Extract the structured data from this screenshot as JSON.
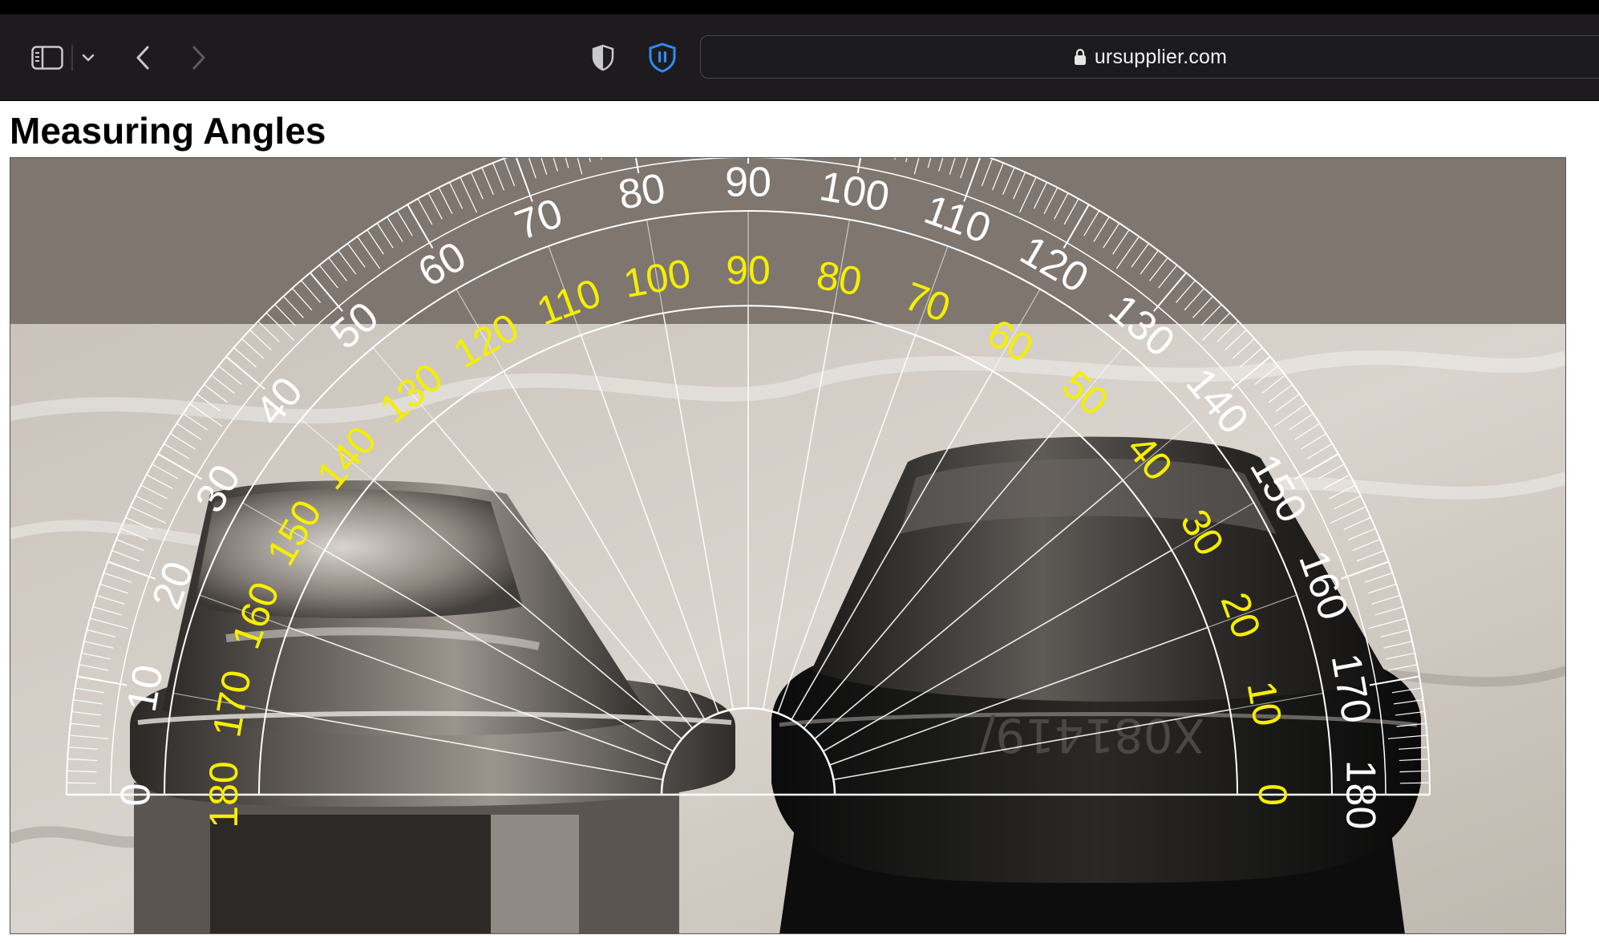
{
  "browser": {
    "url": "ursupplier.com",
    "icons": {
      "sidebar_toggle": "sidebar-icon",
      "sidebar_menu": "chevron-down-icon",
      "back": "chevron-left-icon",
      "forward": "chevron-right-icon",
      "privacy": "shield-icon",
      "extension": "password-manager-shield-icon",
      "secure": "lock-icon"
    },
    "colors": {
      "toolbar": "#1d1b1e",
      "extension_accent": "#2f8cf2"
    }
  },
  "page": {
    "title": "Measuring Angles"
  },
  "protractor": {
    "outer_labels": [
      "0",
      "10",
      "20",
      "30",
      "40",
      "50",
      "60",
      "70",
      "80",
      "90",
      "100",
      "110",
      "120",
      "130",
      "140",
      "150",
      "160",
      "170",
      "180"
    ],
    "inner_labels": [
      "180",
      "170",
      "160",
      "150",
      "140",
      "130",
      "120",
      "110",
      "100",
      "90",
      "80",
      "70",
      "60",
      "50",
      "40",
      "30",
      "20",
      "10",
      "0"
    ],
    "colors": {
      "outer_scale": "#ffffff",
      "inner_scale": "#f5ee00"
    }
  },
  "photo": {
    "lug_nut_marking": "X081419/"
  }
}
